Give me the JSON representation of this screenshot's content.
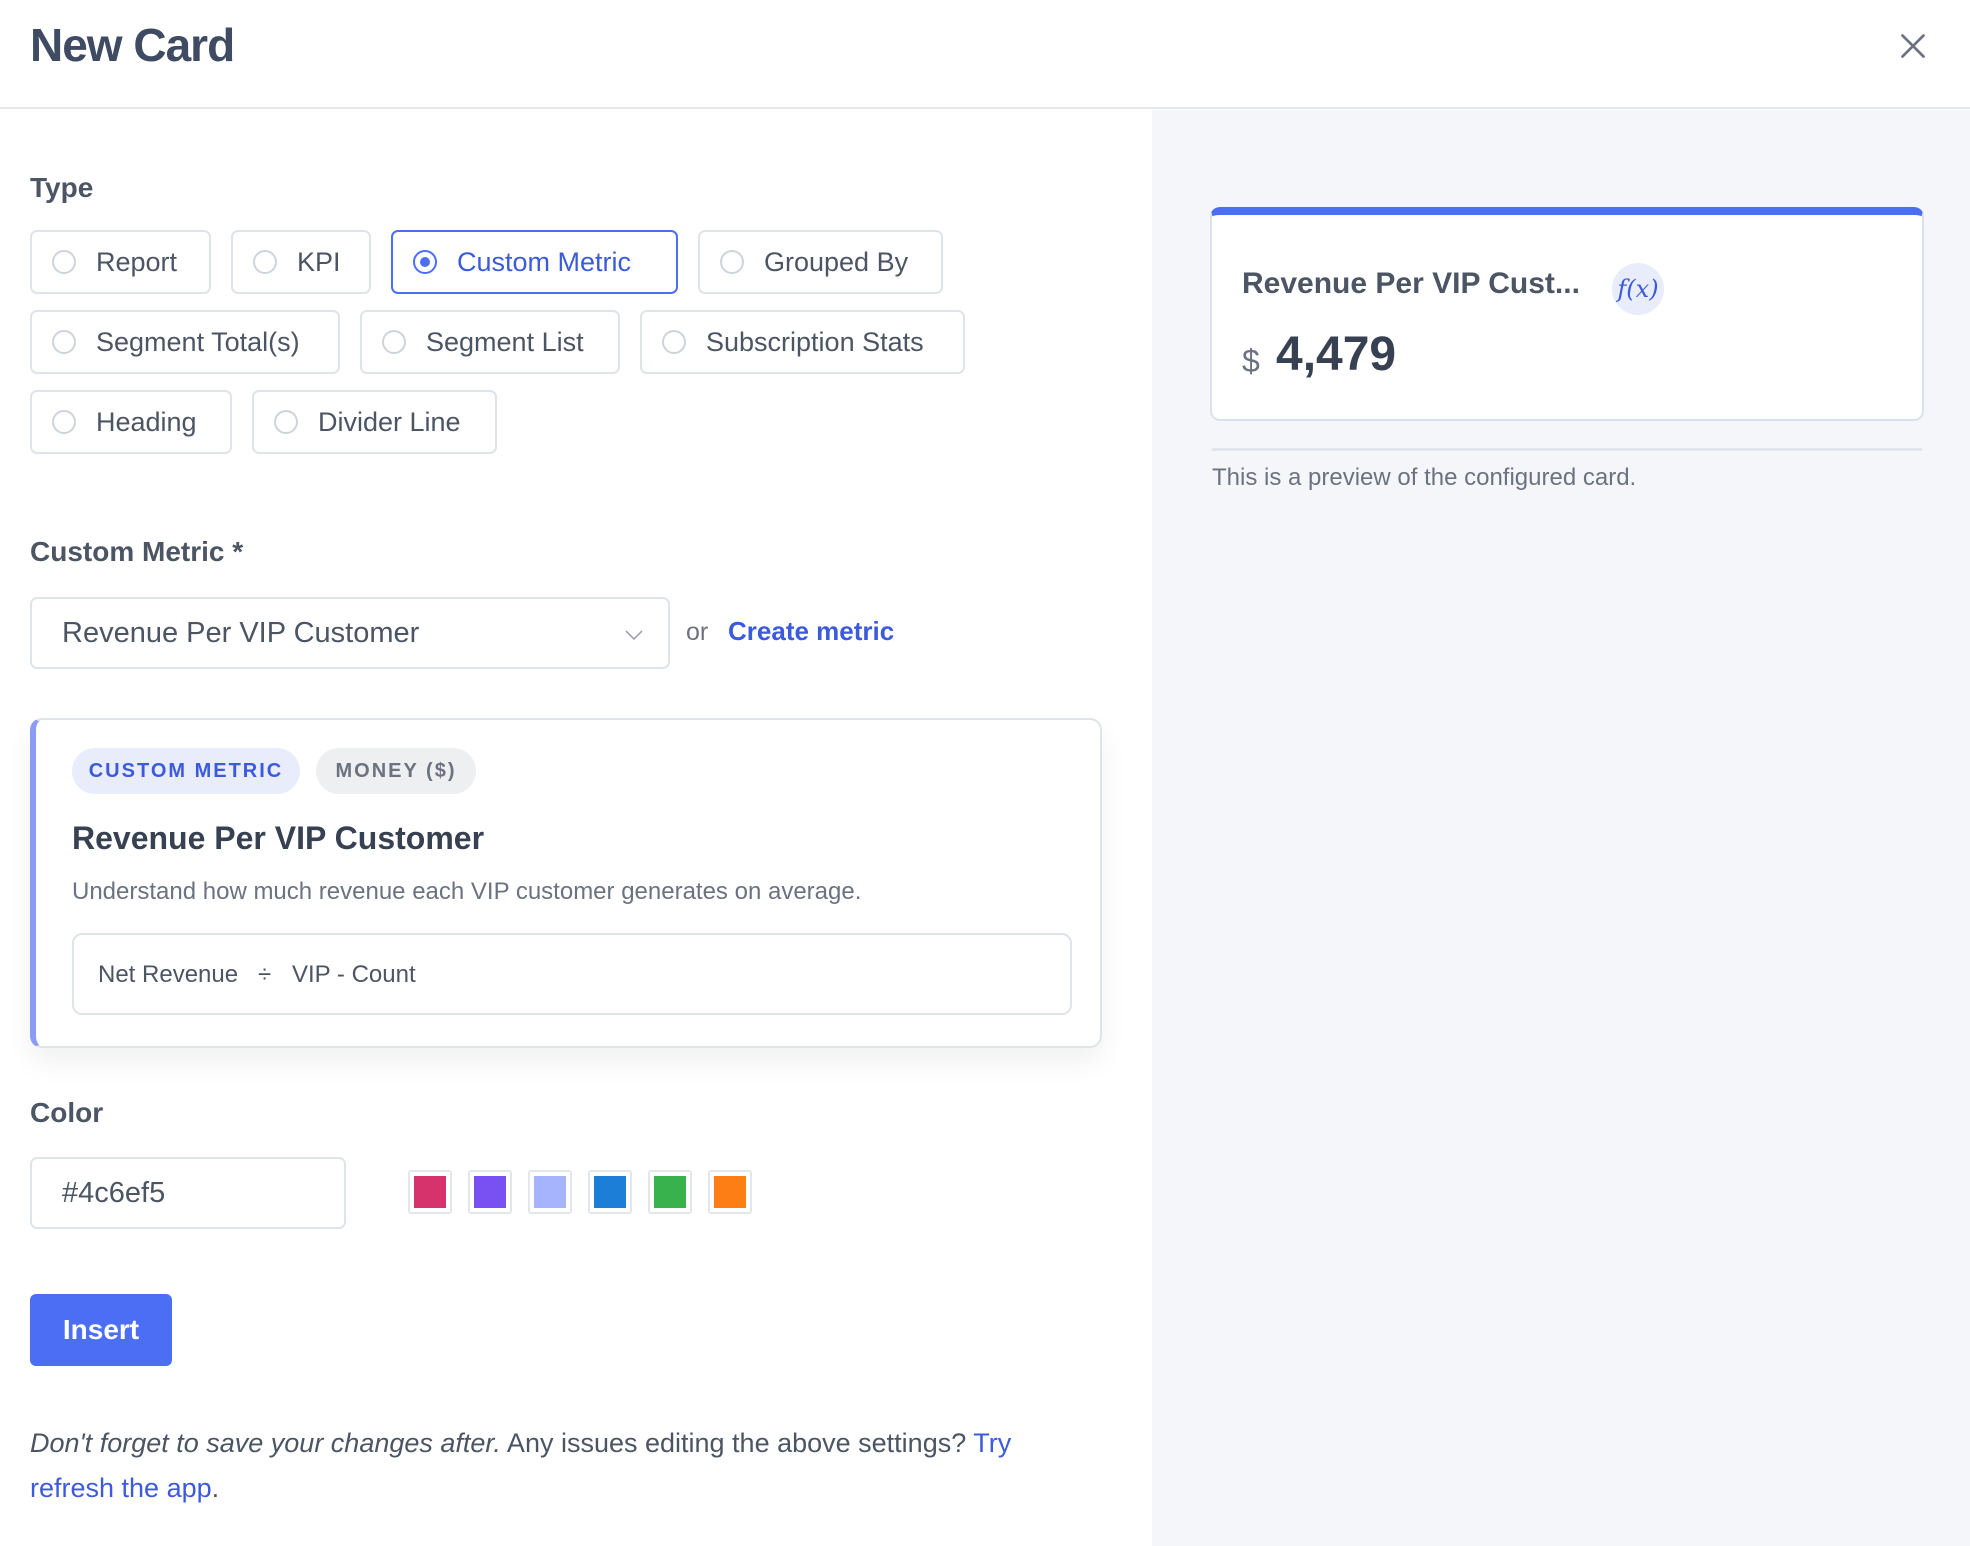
{
  "header": {
    "title": "New Card"
  },
  "type_section": {
    "label": "Type",
    "options": [
      {
        "label": "Report",
        "selected": false
      },
      {
        "label": "KPI",
        "selected": false
      },
      {
        "label": "Custom Metric",
        "selected": true
      },
      {
        "label": "Grouped By",
        "selected": false
      },
      {
        "label": "Segment Total(s)",
        "selected": false
      },
      {
        "label": "Segment List",
        "selected": false
      },
      {
        "label": "Subscription Stats",
        "selected": false
      },
      {
        "label": "Heading",
        "selected": false
      },
      {
        "label": "Divider Line",
        "selected": false
      }
    ]
  },
  "metric_section": {
    "label": "Custom Metric *",
    "selected_value": "Revenue Per VIP Customer",
    "or_text": "or",
    "create_link": "Create metric"
  },
  "metric_card": {
    "badge_type": "CUSTOM METRIC",
    "badge_format": "MONEY ($)",
    "title": "Revenue Per VIP Customer",
    "description": "Understand how much revenue each VIP customer generates on average.",
    "formula": {
      "left": "Net Revenue",
      "operator": "÷",
      "right": "VIP - Count"
    }
  },
  "color_section": {
    "label": "Color",
    "value": "#4c6ef5",
    "swatches": [
      "#d6336c",
      "#7950f2",
      "#a5b4fc",
      "#1c7ed6",
      "#37b24d",
      "#fd7e14"
    ]
  },
  "actions": {
    "insert_label": "Insert"
  },
  "footer": {
    "italic_text": "Don't forget to save your changes after.",
    "plain_text": " Any issues editing the above settings? ",
    "link_text": "Try refresh the app",
    "end_text": "."
  },
  "preview": {
    "accent": "#4c6ef5",
    "title": "Revenue Per VIP Cust...",
    "icon": "function-icon",
    "icon_text": "f(x)",
    "currency": "$",
    "value": "4,479",
    "note": "This is a preview of the configured card."
  }
}
